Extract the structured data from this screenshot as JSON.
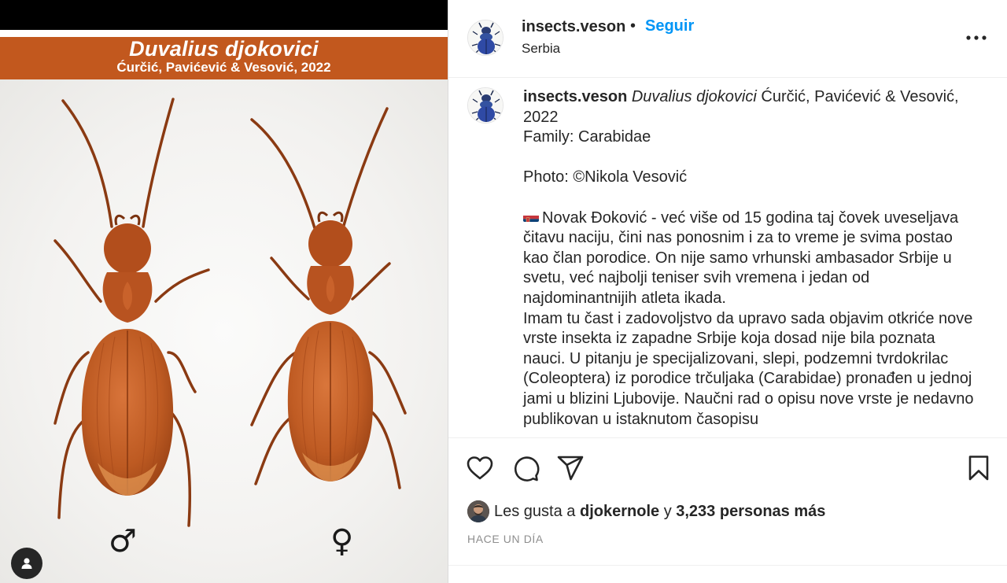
{
  "post_image": {
    "species": "Duvalius djokovici",
    "authors": "Ćurčić, Pavićević & Vesović, 2022",
    "male_symbol": "♂",
    "female_symbol": "♀"
  },
  "header": {
    "username": "insects.veson",
    "separator": "•",
    "follow_label": "Seguir",
    "location": "Serbia"
  },
  "caption": {
    "username": "insects.veson",
    "species": "Duvalius djokovici",
    "authors": "Ćurčić, Pavićević & Vesović, 2022",
    "family": "Family: Carabidae",
    "photo": "Photo: ©Nikola Vesović",
    "paragraph1": "Novak Đoković - već više od 15 godina taj čovek uveseljava čitavu naciju, čini nas ponosnim i za to vreme je svima postao kao član porodice. On nije samo vrhunski ambasador Srbije u svetu, već najbolji teniser svih vremena i jedan od najdominantnijih atleta ikada.",
    "paragraph2": "Imam tu čast i zadovoljstvo da upravo sada objavim otkriće nove vrste insekta iz zapadne Srbije koja dosad nije bila poznata nauci. U pitanju je specijalizovani, slepi, podzemni tvrdokrilac (Coleoptera) iz porodice trčuljaka (Carabidae) pronađen u jednoj jami u blizini Ljubovije. Naučni rad o opisu nove vrste je nedavno publikovan u istaknutom časopisu"
  },
  "likes": {
    "prefix": "Les gusta a",
    "liker": "djokernole",
    "connector": "y",
    "others": "3,233 personas más"
  },
  "timestamp": "HACE UN DÍA",
  "colors": {
    "banner": "#c2581e",
    "link_blue": "#0095f6",
    "text": "#262626",
    "muted": "#8e8e8e",
    "beetle": "#b9541f"
  },
  "icons": [
    "heart-icon",
    "comment-icon",
    "share-icon",
    "bookmark-icon",
    "more-options-icon",
    "user-tag-icon",
    "serbian-flag-icon"
  ]
}
